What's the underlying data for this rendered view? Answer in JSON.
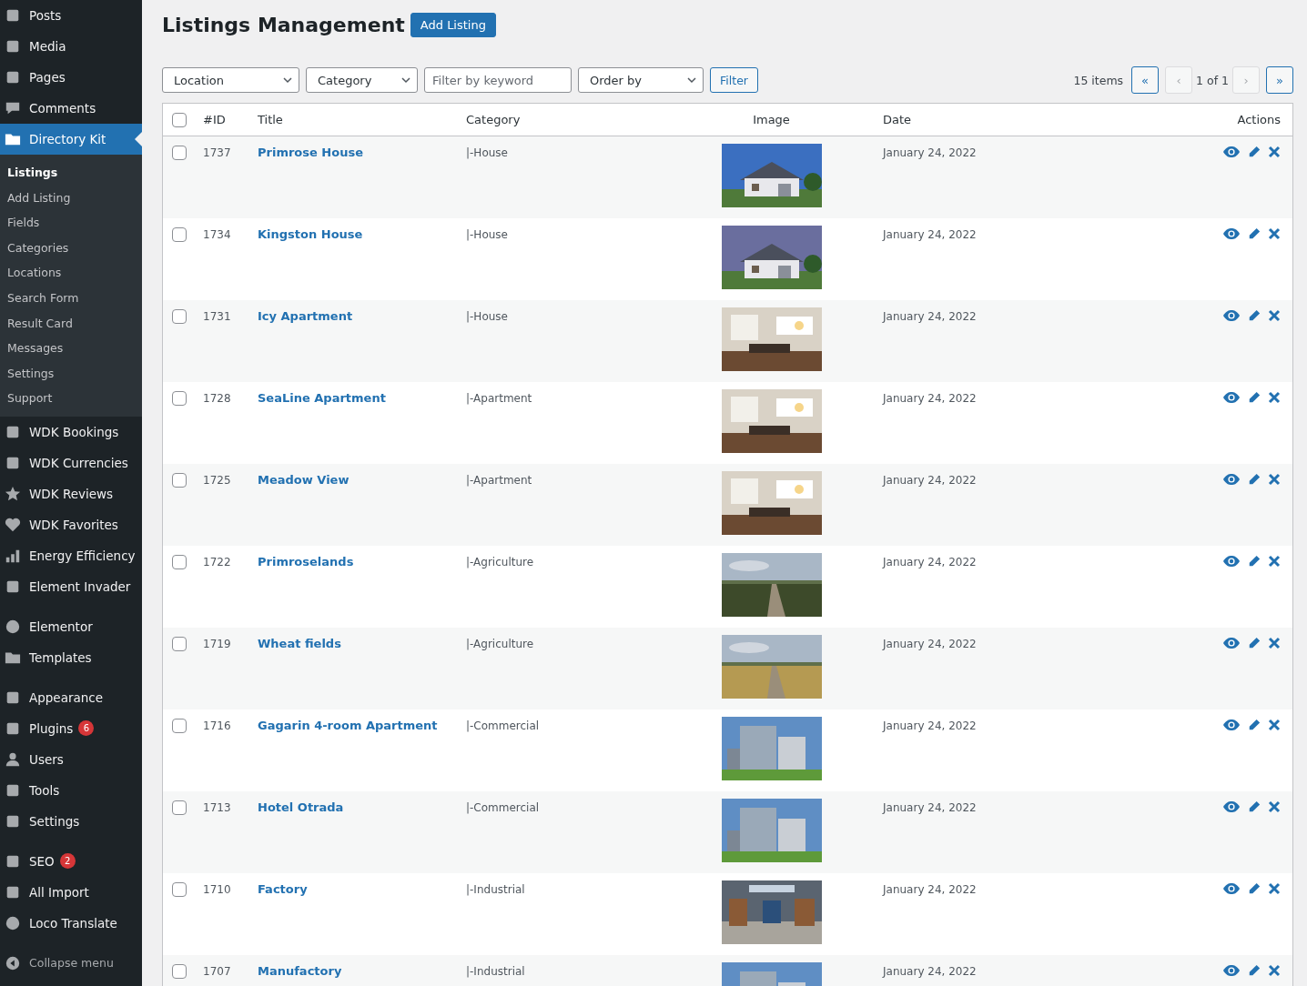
{
  "sidebar": {
    "items": [
      {
        "label": "Posts",
        "current": false,
        "group_start": false
      },
      {
        "label": "Media",
        "current": false,
        "group_start": false
      },
      {
        "label": "Pages",
        "current": false,
        "group_start": false
      },
      {
        "label": "Comments",
        "current": false,
        "group_start": false
      },
      {
        "label": "Directory Kit",
        "current": true,
        "group_start": false,
        "children": [
          {
            "label": "Listings",
            "selected": true
          },
          {
            "label": "Add Listing",
            "selected": false
          },
          {
            "label": "Fields",
            "selected": false
          },
          {
            "label": "Categories",
            "selected": false
          },
          {
            "label": "Locations",
            "selected": false
          },
          {
            "label": "Search Form",
            "selected": false
          },
          {
            "label": "Result Card",
            "selected": false
          },
          {
            "label": "Messages",
            "selected": false
          },
          {
            "label": "Settings",
            "selected": false
          },
          {
            "label": "Support",
            "selected": false
          }
        ]
      },
      {
        "label": "WDK Bookings",
        "current": false,
        "group_start": false
      },
      {
        "label": "WDK Currencies",
        "current": false,
        "group_start": false
      },
      {
        "label": "WDK Reviews",
        "current": false,
        "group_start": false
      },
      {
        "label": "WDK Favorites",
        "current": false,
        "group_start": false
      },
      {
        "label": "Energy Efficiency",
        "current": false,
        "group_start": false
      },
      {
        "label": "Element Invader",
        "current": false,
        "group_start": false
      },
      {
        "label": "Elementor",
        "current": false,
        "group_start": true
      },
      {
        "label": "Templates",
        "current": false,
        "group_start": false
      },
      {
        "label": "Appearance",
        "current": false,
        "group_start": true
      },
      {
        "label": "Plugins",
        "current": false,
        "group_start": false,
        "badge": "6"
      },
      {
        "label": "Users",
        "current": false,
        "group_start": false
      },
      {
        "label": "Tools",
        "current": false,
        "group_start": false
      },
      {
        "label": "Settings",
        "current": false,
        "group_start": false
      },
      {
        "label": "SEO",
        "current": false,
        "group_start": true,
        "badge": "2"
      },
      {
        "label": "All Import",
        "current": false,
        "group_start": false
      },
      {
        "label": "Loco Translate",
        "current": false,
        "group_start": false
      }
    ],
    "collapse": "Collapse menu"
  },
  "header": {
    "title": "Listings Management",
    "add_button": "Add Listing"
  },
  "filters": {
    "location": "Location",
    "category": "Category",
    "keyword_placeholder": "Filter by keyword",
    "order": "Order by",
    "button": "Filter"
  },
  "pagination": {
    "count": "15 items",
    "first": {
      "label": "«",
      "disabled": false
    },
    "prev": {
      "label": "‹",
      "disabled": true
    },
    "page": "1 of 1",
    "next": {
      "label": "›",
      "disabled": true
    },
    "last": {
      "label": "»",
      "disabled": false
    }
  },
  "table": {
    "select_all": {
      "checked": false
    },
    "columns": [
      "#ID",
      "Title",
      "Category",
      "Image",
      "Date",
      "Actions"
    ],
    "rows": [
      {
        "id": "1737",
        "title": "Primrose House",
        "category": "|-House",
        "date": "January 24, 2022",
        "checked": false
      },
      {
        "id": "1734",
        "title": "Kingston House",
        "category": "|-House",
        "date": "January 24, 2022",
        "checked": false
      },
      {
        "id": "1731",
        "title": "Icy Apartment",
        "category": "|-House",
        "date": "January 24, 2022",
        "checked": false
      },
      {
        "id": "1728",
        "title": "SeaLine Apartment",
        "category": "|-Apartment",
        "date": "January 24, 2022",
        "checked": false
      },
      {
        "id": "1725",
        "title": "Meadow View",
        "category": "|-Apartment",
        "date": "January 24, 2022",
        "checked": false
      },
      {
        "id": "1722",
        "title": "Primroselands",
        "category": "|-Agriculture",
        "date": "January 24, 2022",
        "checked": false
      },
      {
        "id": "1719",
        "title": "Wheat fields",
        "category": "|-Agriculture",
        "date": "January 24, 2022",
        "checked": false
      },
      {
        "id": "1716",
        "title": "Gagarin 4-room Apartment",
        "category": "|-Commercial",
        "date": "January 24, 2022",
        "checked": false
      },
      {
        "id": "1713",
        "title": "Hotel Otrada",
        "category": "|-Commercial",
        "date": "January 24, 2022",
        "checked": false
      },
      {
        "id": "1710",
        "title": "Factory",
        "category": "|-Industrial",
        "date": "January 24, 2022",
        "checked": false
      },
      {
        "id": "1707",
        "title": "Manufactory",
        "category": "|-Industrial",
        "date": "January 24, 2022",
        "checked": false
      }
    ]
  }
}
